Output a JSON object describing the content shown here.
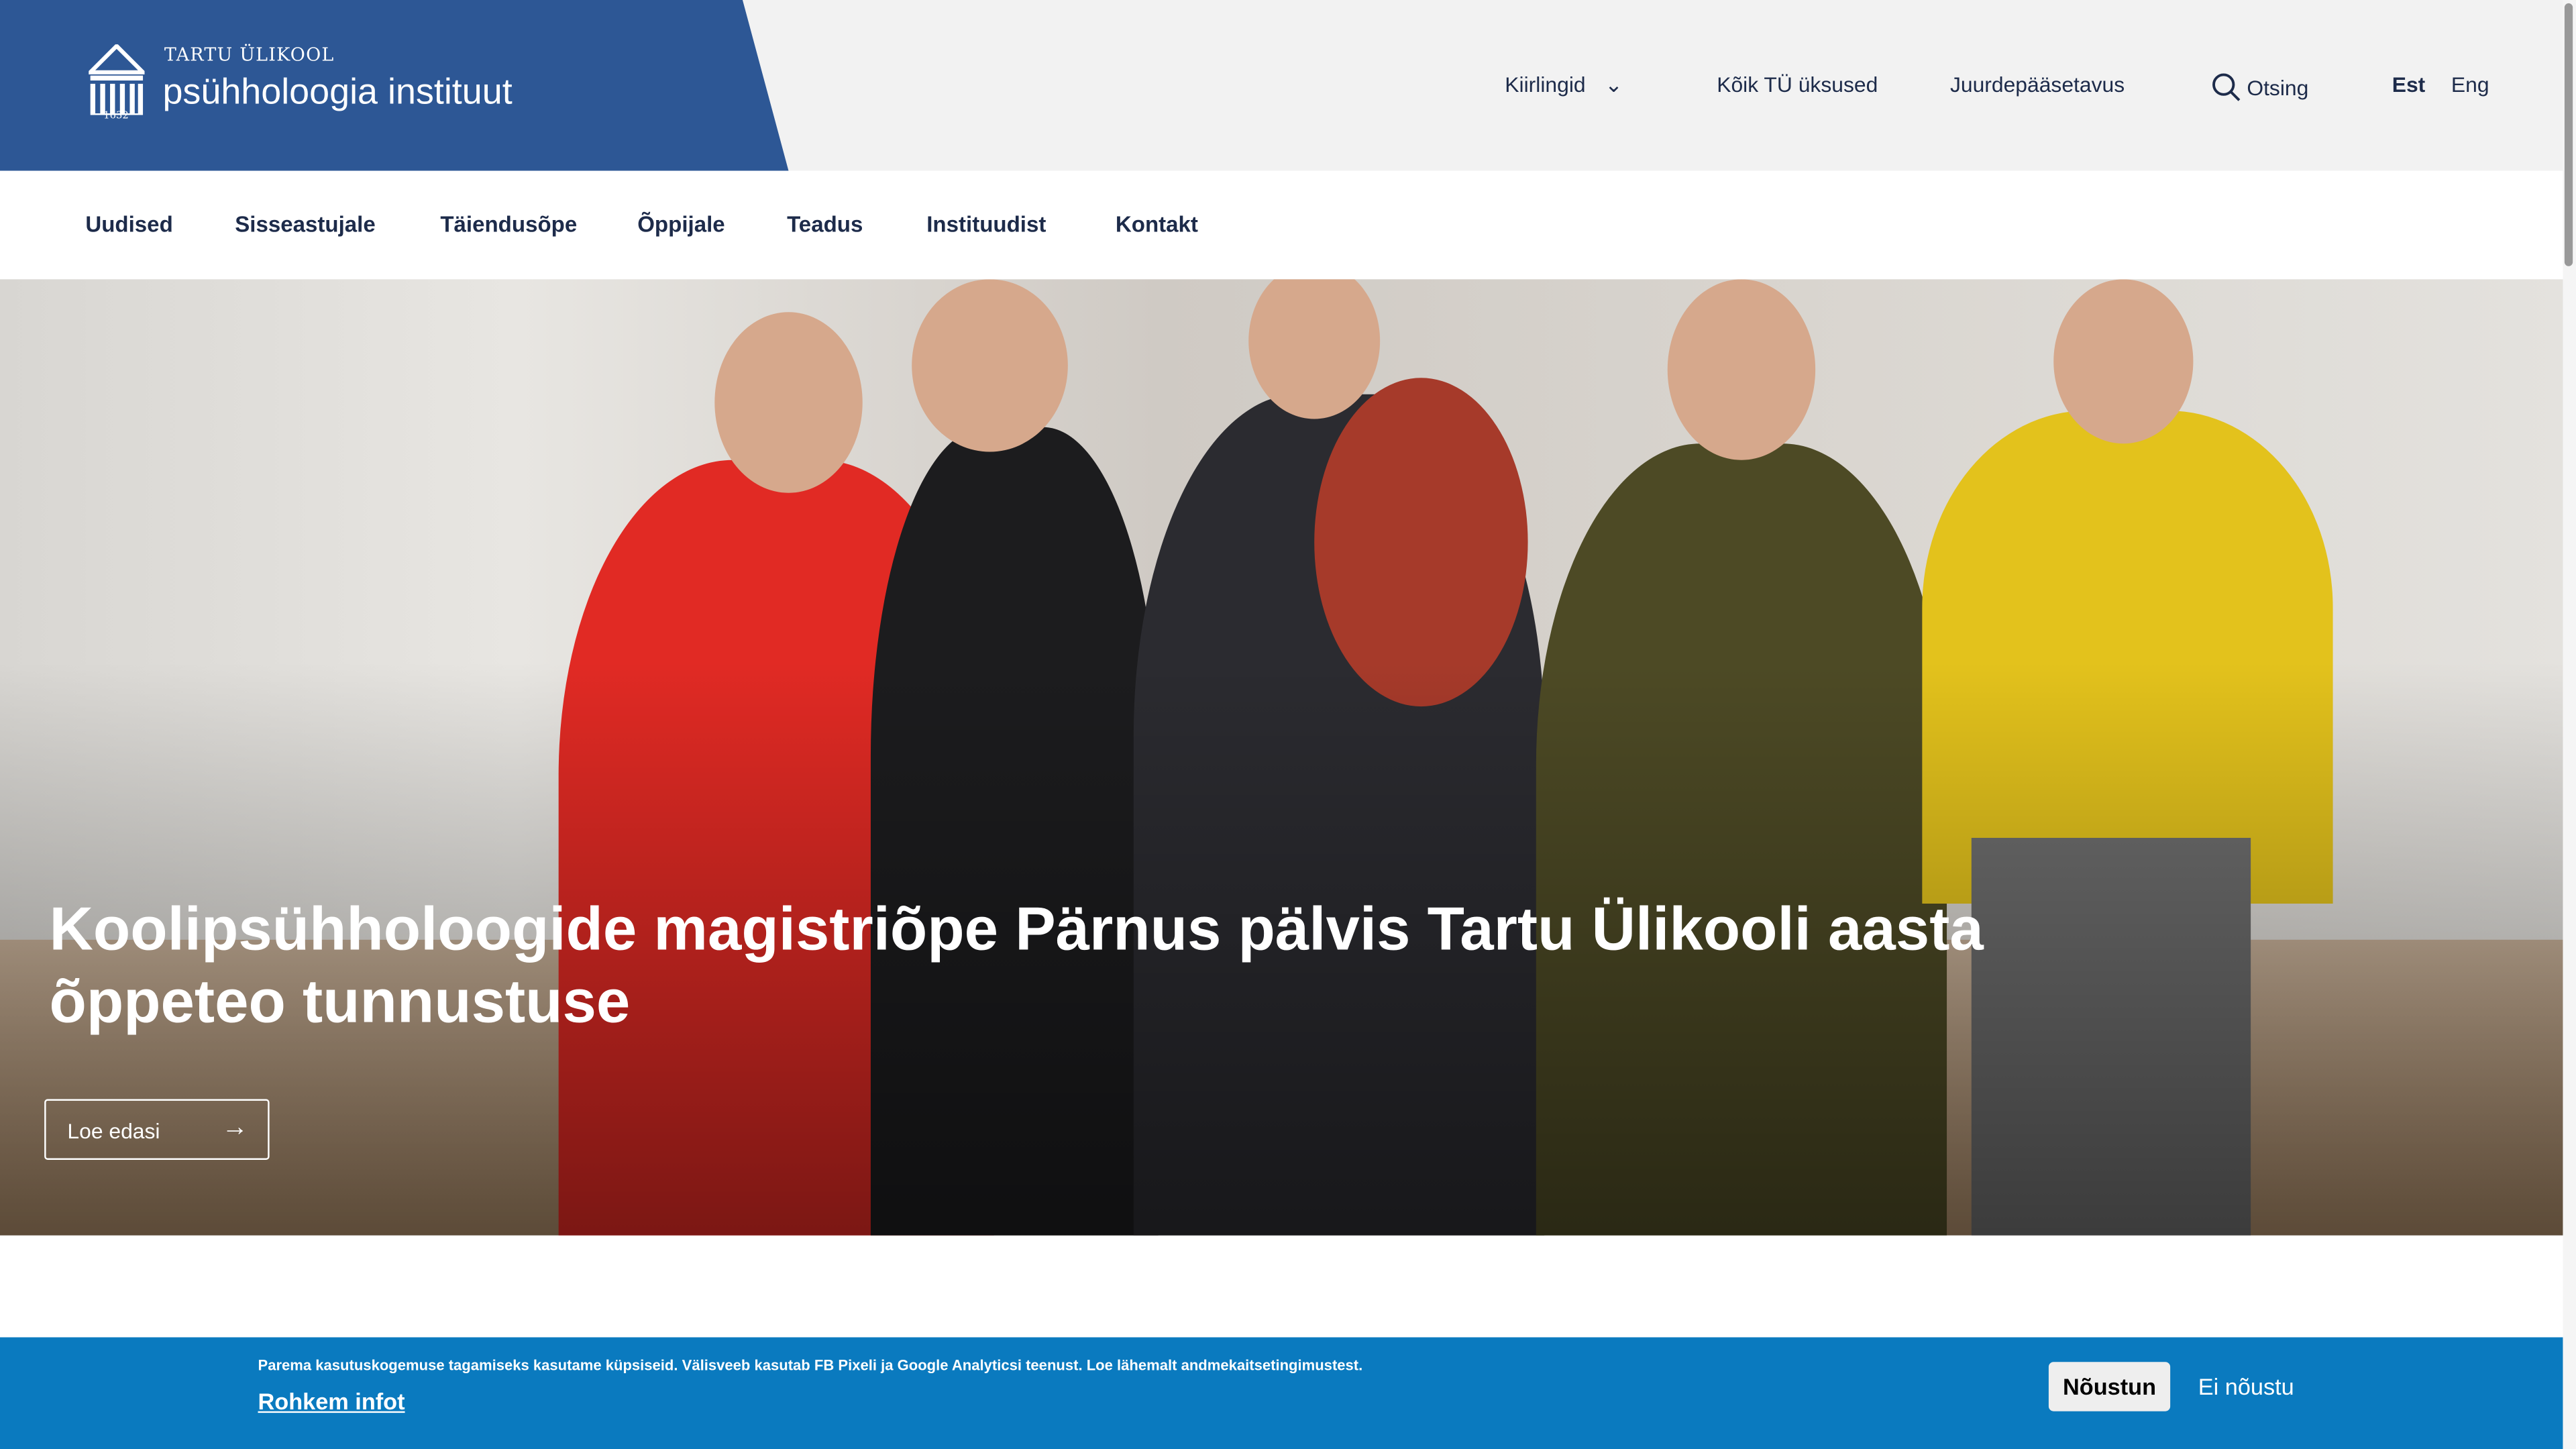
{
  "header": {
    "university": "TARTU ÜLIKOOL",
    "institute": "psühholoogia instituut",
    "year": "1632",
    "links": {
      "quick_links": "Kiirlingid",
      "all_units": "Kõik TÜ üksused",
      "accessibility": "Juurdepääsetavus",
      "search": "Otsing"
    },
    "languages": [
      "Est",
      "Eng"
    ]
  },
  "nav": [
    "Uudised",
    "Sisseastujale",
    "Täiendusõpe",
    "Õppijale",
    "Teadus",
    "Instituudist",
    "Kontakt"
  ],
  "hero": {
    "headline": "Koolipsühholoogide magistriõpe Pärnus pälvis Tartu Ülikooli aasta õppeteo tunnustuse",
    "button": "Loe edasi"
  },
  "cookie": {
    "message": "Parema kasutuskogemuse tagamiseks kasutame küpsiseid. Välisveeb kasutab FB Pixeli ja Google Analyticsi teenust. Loe lähemalt andmekaitsetingimustest.",
    "more": "Rohkem infot",
    "agree": "Nõustun",
    "disagree": "Ei nõustu"
  },
  "colors": {
    "brand": "#2d5795",
    "cookie_bg": "#0a7abf"
  }
}
